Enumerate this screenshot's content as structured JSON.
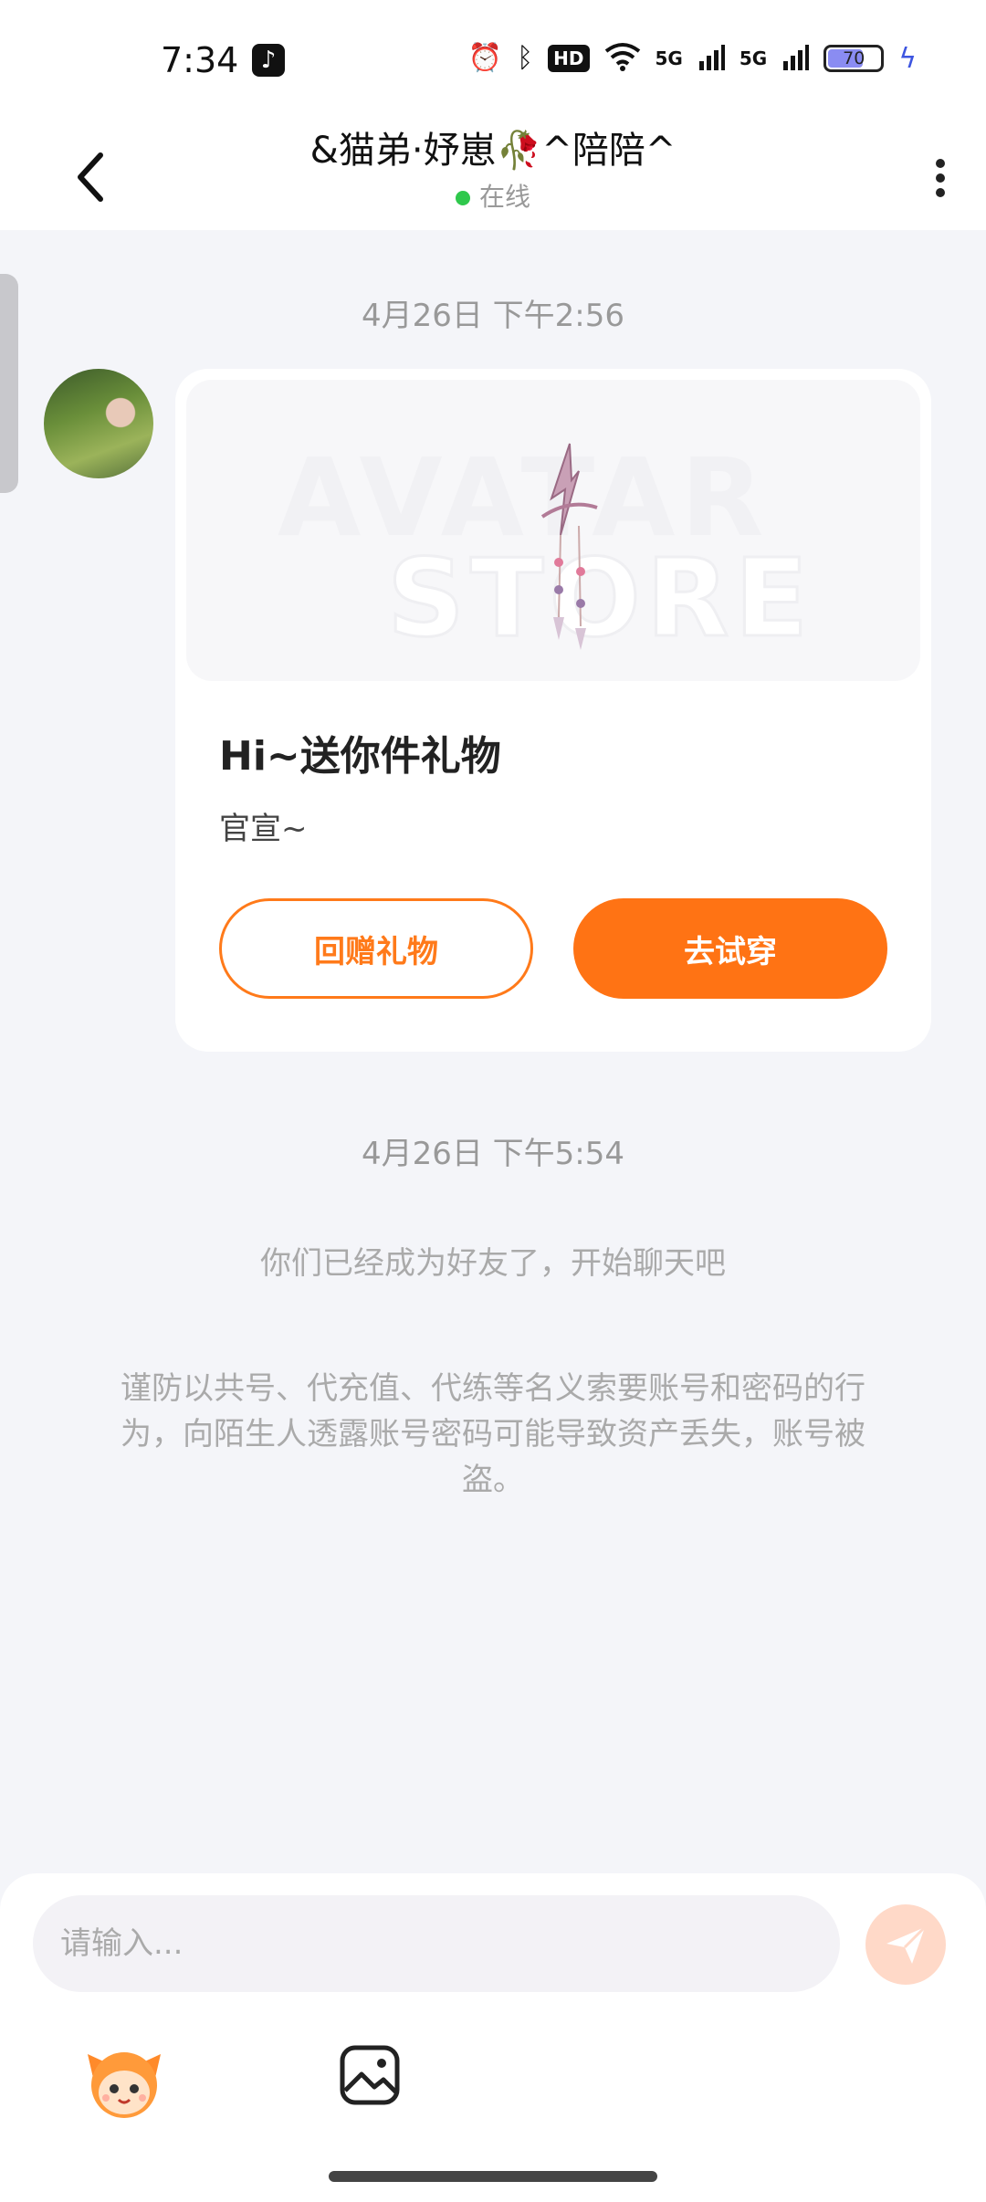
{
  "status_bar": {
    "time": "7:34",
    "network_1": "5G",
    "network_2": "5G",
    "hd_label": "HD",
    "battery": "70",
    "battery_level": 0.7
  },
  "header": {
    "title": "&猫弟·妤崽🥀^陪陪^",
    "status": "在线"
  },
  "messages": {
    "timestamp_1": "4月26日 下午2:56",
    "gift_card": {
      "watermark_line1": "AVATAR",
      "watermark_line2": "STORE",
      "title": "Hi~送你件礼物",
      "subtitle": "官宣~",
      "return_gift_label": "回赠礼物",
      "try_on_label": "去试穿"
    },
    "timestamp_2": "4月26日 下午5:54",
    "friend_notice": "你们已经成为好友了，开始聊天吧",
    "security_warning": "谨防以共号、代充值、代练等名义索要账号和密码的行为，向陌生人透露账号密码可能导致资产丢失，账号被盗。"
  },
  "input": {
    "placeholder": "请输入..."
  },
  "colors": {
    "accent": "#ff7314",
    "online": "#2fc84c",
    "background": "#f4f5f9"
  },
  "icons": [
    "back-icon",
    "more-icon",
    "send-icon",
    "emoji-mascot-icon",
    "image-icon",
    "tiktok-icon",
    "alarm-icon",
    "bluetooth-icon",
    "wifi-icon",
    "battery-icon",
    "charging-icon"
  ]
}
